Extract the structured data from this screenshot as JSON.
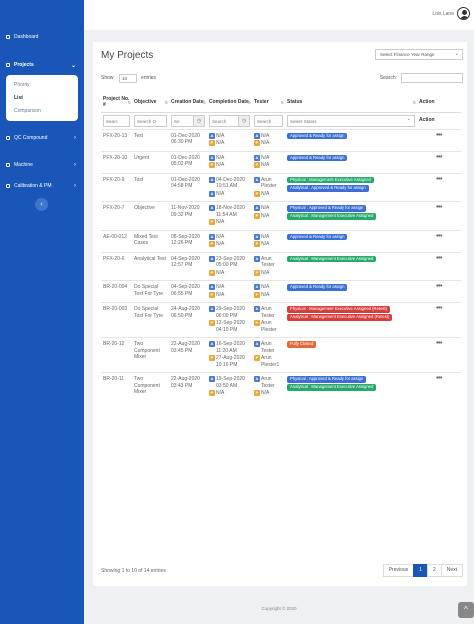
{
  "sidebar": {
    "items": [
      {
        "label": "Dashboard",
        "chevron": ""
      },
      {
        "label": "Projects",
        "chevron": "⌄"
      },
      {
        "label": "QC Compound",
        "chevron": "›"
      },
      {
        "label": "Machine",
        "chevron": "›"
      },
      {
        "label": "Calibration & PM",
        "chevron": "›"
      }
    ],
    "submenu": [
      "Priority",
      "List",
      "Comparison"
    ],
    "collapse_icon": "‹"
  },
  "topbar": {
    "user_name": "Lois Lane",
    "avatar_icon": "user-avatar-icon"
  },
  "page": {
    "title": "My Projects",
    "fy_select": "Select Finance Year Range",
    "show_label": "Show",
    "entries_value": "10",
    "entries_label": "entries",
    "search_label": "Search:"
  },
  "table": {
    "headers": [
      "Project No. #",
      "Objective",
      "Creation Date",
      "Completion Date",
      "Tester",
      "Status",
      "Action"
    ],
    "filters": [
      "Searc",
      "Search O",
      "Se",
      "Search",
      "Search",
      "Select Status",
      "Action"
    ],
    "rows": [
      {
        "no": "PFX-20-13",
        "objective": "Test",
        "created": "01-Dec-2020 06:30 PM",
        "completion": [
          {
            "g": "A",
            "t": "N/A"
          },
          {
            "g": "P",
            "t": "N/A"
          }
        ],
        "tester": [
          {
            "g": "A",
            "t": "N/A"
          },
          {
            "g": "P",
            "t": "N/A"
          }
        ],
        "status": [
          {
            "c": "blue",
            "t": "Approved & Ready for assign"
          }
        ]
      },
      {
        "no": "PFX-20-10",
        "objective": "Urgent",
        "created": "01-Dec-2020 05:02 PM",
        "completion": [
          {
            "g": "A",
            "t": "N/A"
          },
          {
            "g": "P",
            "t": "N/A"
          }
        ],
        "tester": [
          {
            "g": "A",
            "t": "N/A"
          },
          {
            "g": "P",
            "t": "N/A"
          }
        ],
        "status": [
          {
            "c": "blue",
            "t": "Approved & Ready for assign"
          }
        ]
      },
      {
        "no": "PFX-20-9",
        "objective": "Test",
        "created": "01-Dec-2020 04:58 PM",
        "completion": [
          {
            "g": "A",
            "t": "04-Dec-2020 10:51 AM"
          },
          {
            "g": "A",
            "t": "N/A"
          }
        ],
        "tester": [
          {
            "g": "A",
            "t": "Arun Plester"
          },
          {
            "g": "P",
            "t": "N/A"
          }
        ],
        "status": [
          {
            "c": "green",
            "t": "Physical : Management Executive Assigned"
          },
          {
            "c": "blue",
            "t": "Analytical : Approved & Ready for assign"
          }
        ]
      },
      {
        "no": "PFX-20-7",
        "objective": "Objective",
        "created": "11-Nov-2020 09:32 PM",
        "completion": [
          {
            "g": "A",
            "t": "18-Nov-2020 11:54 AM"
          },
          {
            "g": "P",
            "t": "N/A"
          }
        ],
        "tester": [
          {
            "g": "A",
            "t": "N/A"
          },
          {
            "g": "P",
            "t": "N/A"
          }
        ],
        "status": [
          {
            "c": "blue",
            "t": "Physical : Approved & Ready for assign"
          },
          {
            "c": "green",
            "t": "Analytical : Management Executive Assigned"
          }
        ]
      },
      {
        "no": "AE-00-012",
        "objective": "Mixed Test Cases",
        "created": "08-Sep-2020 12:26 PM",
        "completion": [
          {
            "g": "A",
            "t": "N/A"
          },
          {
            "g": "P",
            "t": "N/A"
          }
        ],
        "tester": [
          {
            "g": "A",
            "t": "N/A"
          },
          {
            "g": "P",
            "t": "N/A"
          }
        ],
        "status": [
          {
            "c": "blue",
            "t": "Approved & Ready for assign"
          }
        ]
      },
      {
        "no": "PFX-20-6",
        "objective": "Analytical Test",
        "created": "04-Sep-2020 12:57 PM",
        "completion": [
          {
            "g": "A",
            "t": "23-Sep-2020 05:00 PM"
          },
          {
            "g": "P",
            "t": "N/A"
          }
        ],
        "tester": [
          {
            "g": "A",
            "t": "Arun Tester"
          },
          {
            "g": "P",
            "t": "N/A"
          }
        ],
        "status": [
          {
            "c": "green",
            "t": "Analytical : Management Executive Assigned"
          }
        ]
      },
      {
        "no": "BR-20-004",
        "objective": "Do Special Test For Tyre",
        "created": "04-Sep-2020 06:55 PM",
        "completion": [
          {
            "g": "A",
            "t": "N/A"
          },
          {
            "g": "P",
            "t": "N/A"
          }
        ],
        "tester": [
          {
            "g": "A",
            "t": "N/A"
          },
          {
            "g": "P",
            "t": "N/A"
          }
        ],
        "status": [
          {
            "c": "blue",
            "t": "Approved & Ready for assign"
          }
        ]
      },
      {
        "no": "BR-20-003",
        "objective": "Do Special Test For Tyre",
        "created": "24-Aug-2020 06:50 PM",
        "completion": [
          {
            "g": "A",
            "t": "29-Sep-2020 06:00 PM"
          },
          {
            "g": "P",
            "t": "12-Sep-2020 04:10 PM"
          }
        ],
        "tester": [
          {
            "g": "A",
            "t": "Arun Tester"
          },
          {
            "g": "P",
            "t": "Arun Plester"
          }
        ],
        "status": [
          {
            "c": "red",
            "t": "Physical : Management Executive Assigned (Retest)"
          },
          {
            "c": "red",
            "t": "Analytical : Management Executive Assigned (Retest)"
          }
        ]
      },
      {
        "no": "BR-20-12",
        "objective": "Two Component Mixer",
        "created": "22-Aug-2020 03:45 PM",
        "completion": [
          {
            "g": "A",
            "t": "16-Sep-2020 11:20 AM"
          },
          {
            "g": "P",
            "t": "27-Aug-2020 10:16 PM"
          }
        ],
        "tester": [
          {
            "g": "A",
            "t": "Arun Tester"
          },
          {
            "g": "P",
            "t": "Arun Plester1"
          }
        ],
        "status": [
          {
            "c": "orange",
            "t": "Fully Closed"
          }
        ]
      },
      {
        "no": "BR-20-11",
        "objective": "Two Component Mixer",
        "created": "22-Aug-2020 03:43 PM",
        "completion": [
          {
            "g": "A",
            "t": "19-Sep-2020 03:50 AM"
          },
          {
            "g": "P",
            "t": "N/A"
          }
        ],
        "tester": [
          {
            "g": "A",
            "t": "Arun Tester"
          },
          {
            "g": "P",
            "t": "N/A"
          }
        ],
        "status": [
          {
            "c": "blue",
            "t": "Physical : Approved & Ready for assign"
          },
          {
            "c": "green",
            "t": "Analytical : Management Executive Assigned"
          }
        ]
      }
    ]
  },
  "footer": {
    "info": "Showing 1 to 10 of 14 entries",
    "pager": [
      "Previous",
      "1",
      "2",
      "Next"
    ],
    "copyright": "Copyright © 2020",
    "scroll_top_icon": "^"
  },
  "colors": {
    "sidebar": "#1a56b8",
    "approved": "#3b6fd3",
    "assigned": "#28a86b",
    "retest": "#d63d3d",
    "closed": "#e06a3a"
  }
}
